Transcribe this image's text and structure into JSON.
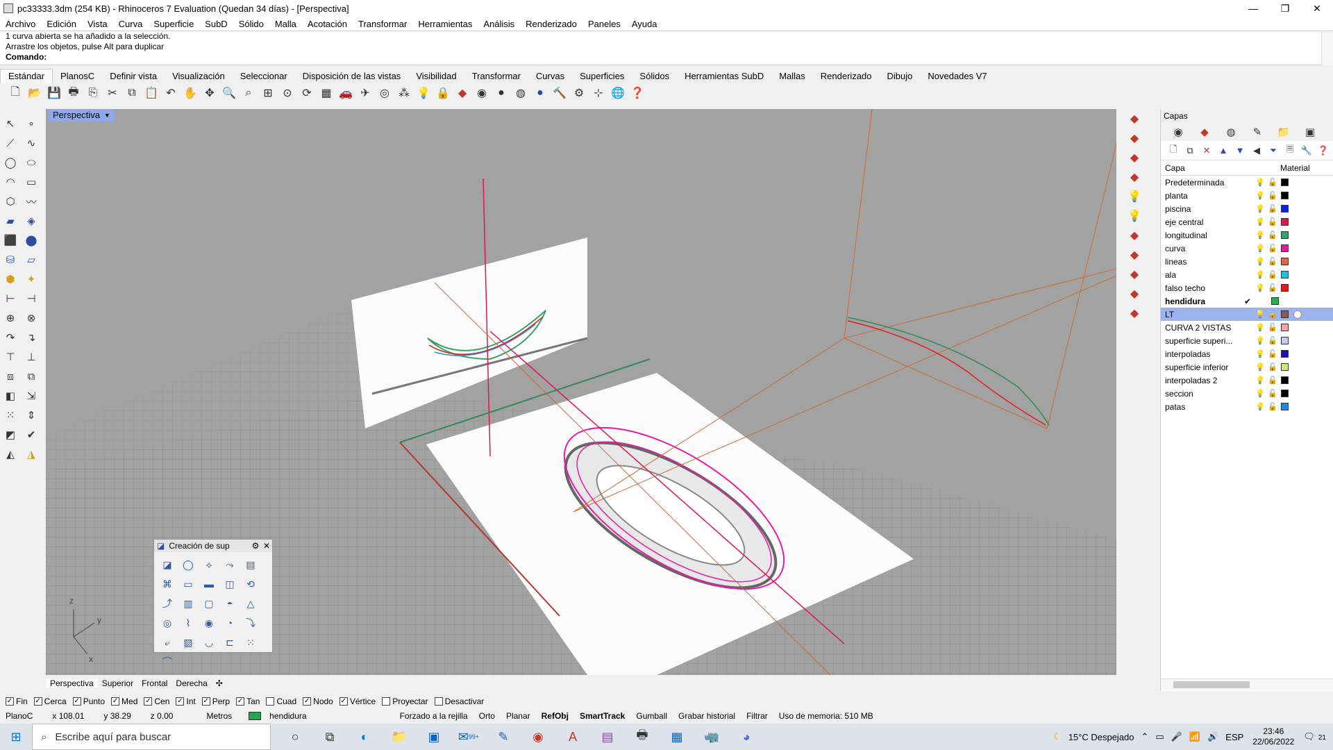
{
  "window": {
    "title": "pc33333.3dm (254 KB) - Rhinoceros 7 Evaluation (Quedan 34 días) - [Perspectiva]",
    "min_glyph": "—",
    "max_glyph": "❐",
    "close_glyph": "✕"
  },
  "menu": [
    "Archivo",
    "Edición",
    "Vista",
    "Curva",
    "Superficie",
    "SubD",
    "Sólido",
    "Malla",
    "Acotación",
    "Transformar",
    "Herramientas",
    "Análisis",
    "Renderizado",
    "Paneles",
    "Ayuda"
  ],
  "command": {
    "history1": "1 curva abierta se ha añadido a la selección.",
    "history2": "Arrastre los objetos, pulse Alt para duplicar",
    "prompt": "Comando:"
  },
  "tabs": [
    "Estándar",
    "PlanosC",
    "Definir vista",
    "Visualización",
    "Seleccionar",
    "Disposición de las vistas",
    "Visibilidad",
    "Transformar",
    "Curvas",
    "Superficies",
    "Sólidos",
    "Herramientas SubD",
    "Mallas",
    "Renderizado",
    "Dibujo",
    "Novedades V7"
  ],
  "toolbar_icons": [
    "new-file-icon",
    "open-icon",
    "save-icon",
    "print-icon",
    "import-icon",
    "cut-icon",
    "copy-icon",
    "paste-icon",
    "undo-icon",
    "pan-icon",
    "move-view-icon",
    "zoom-icon",
    "zoom-window-icon",
    "zoom-extents-icon",
    "zoom-selected-icon",
    "rotate-view-icon",
    "four-viewports-icon",
    "car-icon",
    "plane-icon",
    "point-icon",
    "snap-icon",
    "light-icon",
    "lock-icon",
    "layer-icon",
    "color-wheel-icon",
    "shade-icon",
    "render-icon",
    "material-icon",
    "hammer-icon",
    "gear-icon",
    "grid-icon",
    "globe-icon",
    "help-icon"
  ],
  "viewport": {
    "label": "Perspectiva",
    "axis_x": "x",
    "axis_y": "y",
    "axis_z": "z"
  },
  "layers": {
    "panel_title": "Capas",
    "col_layer": "Capa",
    "col_material": "Material",
    "rows": [
      {
        "name": "Predeterminada",
        "color": "#000000"
      },
      {
        "name": "planta",
        "color": "#000000"
      },
      {
        "name": "piscina",
        "color": "#0b24d6"
      },
      {
        "name": "eje central",
        "color": "#e0154f"
      },
      {
        "name": "longitudinal",
        "color": "#3aa068"
      },
      {
        "name": "curva",
        "color": "#e61aa6"
      },
      {
        "name": "lineas",
        "color": "#d66a4a"
      },
      {
        "name": "ala",
        "color": "#18c3e0"
      },
      {
        "name": "falso techo",
        "color": "#e01b1b"
      },
      {
        "name": "hendidura",
        "color": "#20b34a",
        "current": true
      },
      {
        "name": "LT",
        "color": "#8a5a4a",
        "selected": true
      },
      {
        "name": "CURVA 2 VISTAS",
        "color": "#f0a8a8"
      },
      {
        "name": "superficie superi...",
        "color": "#c8c8f0"
      },
      {
        "name": "interpoladas",
        "color": "#1a12b8"
      },
      {
        "name": "superficie inferior",
        "color": "#c8e87a"
      },
      {
        "name": "interpoladas 2",
        "color": "#000000"
      },
      {
        "name": "seccion",
        "color": "#000000"
      },
      {
        "name": "patas",
        "color": "#1a8ce0"
      }
    ]
  },
  "view_tabs": [
    "Perspectiva",
    "Superior",
    "Frontal",
    "Derecha"
  ],
  "osnap": [
    {
      "label": "Fin",
      "checked": true
    },
    {
      "label": "Cerca",
      "checked": true
    },
    {
      "label": "Punto",
      "checked": true
    },
    {
      "label": "Med",
      "checked": true
    },
    {
      "label": "Cen",
      "checked": true
    },
    {
      "label": "Int",
      "checked": true
    },
    {
      "label": "Perp",
      "checked": true
    },
    {
      "label": "Tan",
      "checked": true
    },
    {
      "label": "Cuad",
      "checked": false
    },
    {
      "label": "Nodo",
      "checked": true
    },
    {
      "label": "Vértice",
      "checked": true
    },
    {
      "label": "Proyectar",
      "checked": false
    },
    {
      "label": "Desactivar",
      "checked": false
    }
  ],
  "status": {
    "cplane": "PlanoC",
    "x": "x 108.01",
    "y": "y 38.29",
    "z": "z 0.00",
    "units": "Metros",
    "layer": "hendidura",
    "grid_snap": "Forzado a la rejilla",
    "ortho": "Orto",
    "planar": "Planar",
    "refobj": "RefObj",
    "smarttrack": "SmartTrack",
    "gumball": "Gumball",
    "history": "Grabar historial",
    "filter": "Filtrar",
    "memory": "Uso de memoria: 510 MB"
  },
  "floating_toolbar": {
    "title": "Creación de sup",
    "icons": [
      "surface-from-points-icon",
      "sphere-icon",
      "loft-icon",
      "sweep-icon",
      "patch-icon",
      "network-icon",
      "plane-icon",
      "rectangle-plane-icon",
      "edge-surface-icon",
      "revolve-icon",
      "rail-revolve-icon",
      "extrude-icon",
      "box-surface-icon",
      "cylinder-icon",
      "cone-icon",
      "torus-icon",
      "pipe-icon",
      "ellipsoid-icon",
      "drape-icon",
      "sweep1-icon",
      "sweep2-icon",
      "heightfield-icon",
      "paraboloid-icon",
      "tube-icon",
      "point-grid-icon",
      "blend-icon"
    ]
  },
  "taskbar": {
    "search_placeholder": "Escribe aquí para buscar",
    "weather": "15°C  Despejado",
    "lang": "ESP",
    "time": "23:46",
    "date": "22/06/2022",
    "notif_count": "21",
    "mail_badge": "99+"
  }
}
